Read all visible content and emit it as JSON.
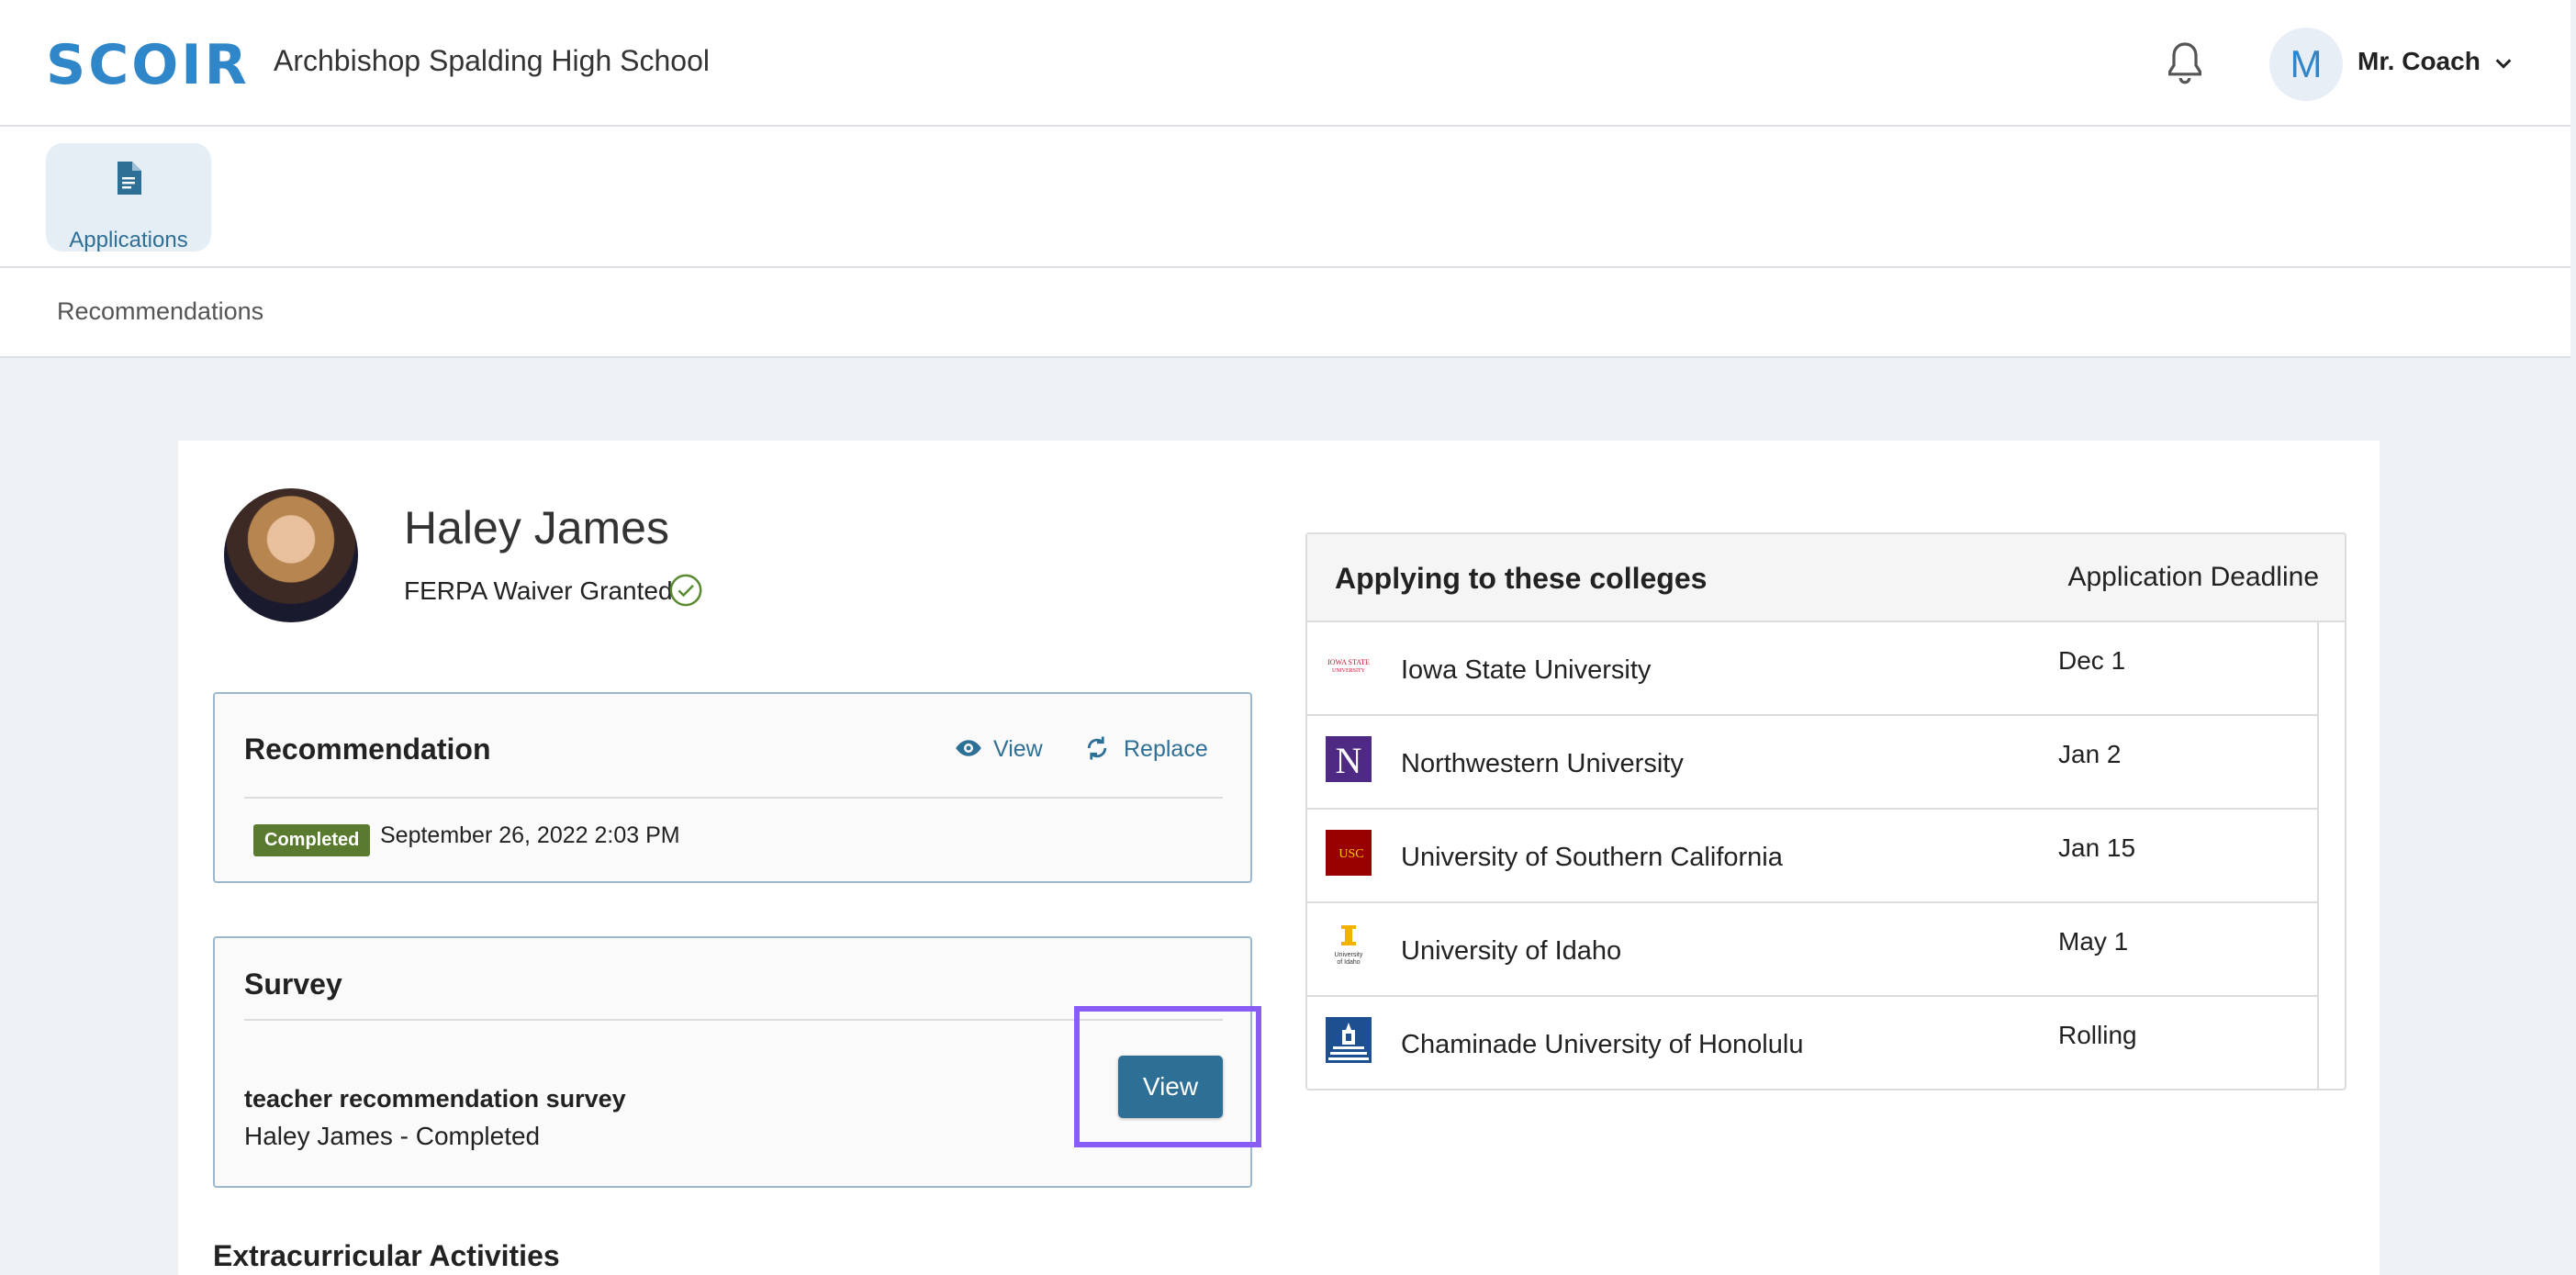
{
  "header": {
    "logo": "SCOIR",
    "school": "Archbishop Spalding High School",
    "avatar_initial": "M",
    "user_name": "Mr. Coach"
  },
  "nav": {
    "applications_label": "Applications"
  },
  "subnav": {
    "label": "Recommendations"
  },
  "student": {
    "name": "Haley James",
    "ferpa": "FERPA Waiver Granted"
  },
  "recommendation": {
    "title": "Recommendation",
    "view_label": "View",
    "replace_label": "Replace",
    "status_badge": "Completed",
    "date": "September 26, 2022 2:03 PM"
  },
  "survey": {
    "title": "Survey",
    "name": "teacher recommendation survey",
    "status": "Haley James - Completed",
    "view_button": "View"
  },
  "extracurricular_title": "Extracurricular Activities",
  "colleges": {
    "header": "Applying to these colleges",
    "deadline_header": "Application Deadline",
    "rows": [
      {
        "name": "Iowa State University",
        "deadline": "Dec 1",
        "logo_text": "IOWA STATE UNIVERSITY",
        "logo_color": "#c8102e"
      },
      {
        "name": "Northwestern University",
        "deadline": "Jan 2",
        "logo_text": "N",
        "logo_color": "#4e2a84"
      },
      {
        "name": "University of Southern California",
        "deadline": "Jan 15",
        "logo_text": "USC",
        "logo_color": "#990000"
      },
      {
        "name": "University of Idaho",
        "deadline": "May 1",
        "logo_text": "University of Idaho",
        "logo_color": "#f1b300"
      },
      {
        "name": "Chaminade University of Honolulu",
        "deadline": "Rolling",
        "logo_text": "",
        "logo_color": "#1d4f91"
      }
    ]
  },
  "colors": {
    "brand": "#2f86c8",
    "primary_button": "#2e6f96",
    "completed_badge": "#5a7a2f",
    "highlight": "#8a5cf6"
  }
}
